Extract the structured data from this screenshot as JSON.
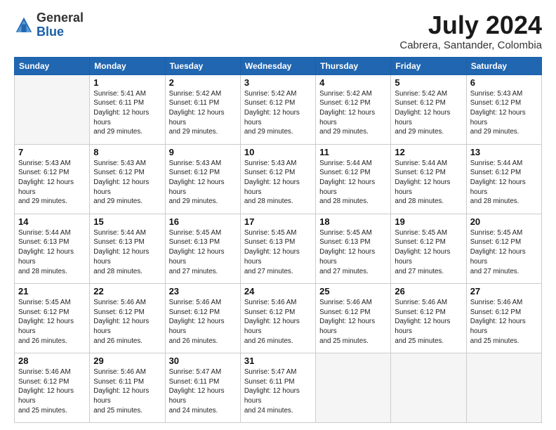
{
  "logo": {
    "general": "General",
    "blue": "Blue"
  },
  "title": "July 2024",
  "subtitle": "Cabrera, Santander, Colombia",
  "days_of_week": [
    "Sunday",
    "Monday",
    "Tuesday",
    "Wednesday",
    "Thursday",
    "Friday",
    "Saturday"
  ],
  "weeks": [
    [
      {
        "day": "",
        "sunrise": "",
        "sunset": "",
        "daylight": ""
      },
      {
        "day": "1",
        "sunrise": "Sunrise: 5:41 AM",
        "sunset": "Sunset: 6:11 PM",
        "daylight": "Daylight: 12 hours and 29 minutes."
      },
      {
        "day": "2",
        "sunrise": "Sunrise: 5:42 AM",
        "sunset": "Sunset: 6:11 PM",
        "daylight": "Daylight: 12 hours and 29 minutes."
      },
      {
        "day": "3",
        "sunrise": "Sunrise: 5:42 AM",
        "sunset": "Sunset: 6:12 PM",
        "daylight": "Daylight: 12 hours and 29 minutes."
      },
      {
        "day": "4",
        "sunrise": "Sunrise: 5:42 AM",
        "sunset": "Sunset: 6:12 PM",
        "daylight": "Daylight: 12 hours and 29 minutes."
      },
      {
        "day": "5",
        "sunrise": "Sunrise: 5:42 AM",
        "sunset": "Sunset: 6:12 PM",
        "daylight": "Daylight: 12 hours and 29 minutes."
      },
      {
        "day": "6",
        "sunrise": "Sunrise: 5:43 AM",
        "sunset": "Sunset: 6:12 PM",
        "daylight": "Daylight: 12 hours and 29 minutes."
      }
    ],
    [
      {
        "day": "7",
        "sunrise": "Sunrise: 5:43 AM",
        "sunset": "Sunset: 6:12 PM",
        "daylight": "Daylight: 12 hours and 29 minutes."
      },
      {
        "day": "8",
        "sunrise": "Sunrise: 5:43 AM",
        "sunset": "Sunset: 6:12 PM",
        "daylight": "Daylight: 12 hours and 29 minutes."
      },
      {
        "day": "9",
        "sunrise": "Sunrise: 5:43 AM",
        "sunset": "Sunset: 6:12 PM",
        "daylight": "Daylight: 12 hours and 29 minutes."
      },
      {
        "day": "10",
        "sunrise": "Sunrise: 5:43 AM",
        "sunset": "Sunset: 6:12 PM",
        "daylight": "Daylight: 12 hours and 28 minutes."
      },
      {
        "day": "11",
        "sunrise": "Sunrise: 5:44 AM",
        "sunset": "Sunset: 6:12 PM",
        "daylight": "Daylight: 12 hours and 28 minutes."
      },
      {
        "day": "12",
        "sunrise": "Sunrise: 5:44 AM",
        "sunset": "Sunset: 6:12 PM",
        "daylight": "Daylight: 12 hours and 28 minutes."
      },
      {
        "day": "13",
        "sunrise": "Sunrise: 5:44 AM",
        "sunset": "Sunset: 6:12 PM",
        "daylight": "Daylight: 12 hours and 28 minutes."
      }
    ],
    [
      {
        "day": "14",
        "sunrise": "Sunrise: 5:44 AM",
        "sunset": "Sunset: 6:13 PM",
        "daylight": "Daylight: 12 hours and 28 minutes."
      },
      {
        "day": "15",
        "sunrise": "Sunrise: 5:44 AM",
        "sunset": "Sunset: 6:13 PM",
        "daylight": "Daylight: 12 hours and 28 minutes."
      },
      {
        "day": "16",
        "sunrise": "Sunrise: 5:45 AM",
        "sunset": "Sunset: 6:13 PM",
        "daylight": "Daylight: 12 hours and 27 minutes."
      },
      {
        "day": "17",
        "sunrise": "Sunrise: 5:45 AM",
        "sunset": "Sunset: 6:13 PM",
        "daylight": "Daylight: 12 hours and 27 minutes."
      },
      {
        "day": "18",
        "sunrise": "Sunrise: 5:45 AM",
        "sunset": "Sunset: 6:13 PM",
        "daylight": "Daylight: 12 hours and 27 minutes."
      },
      {
        "day": "19",
        "sunrise": "Sunrise: 5:45 AM",
        "sunset": "Sunset: 6:12 PM",
        "daylight": "Daylight: 12 hours and 27 minutes."
      },
      {
        "day": "20",
        "sunrise": "Sunrise: 5:45 AM",
        "sunset": "Sunset: 6:12 PM",
        "daylight": "Daylight: 12 hours and 27 minutes."
      }
    ],
    [
      {
        "day": "21",
        "sunrise": "Sunrise: 5:45 AM",
        "sunset": "Sunset: 6:12 PM",
        "daylight": "Daylight: 12 hours and 26 minutes."
      },
      {
        "day": "22",
        "sunrise": "Sunrise: 5:46 AM",
        "sunset": "Sunset: 6:12 PM",
        "daylight": "Daylight: 12 hours and 26 minutes."
      },
      {
        "day": "23",
        "sunrise": "Sunrise: 5:46 AM",
        "sunset": "Sunset: 6:12 PM",
        "daylight": "Daylight: 12 hours and 26 minutes."
      },
      {
        "day": "24",
        "sunrise": "Sunrise: 5:46 AM",
        "sunset": "Sunset: 6:12 PM",
        "daylight": "Daylight: 12 hours and 26 minutes."
      },
      {
        "day": "25",
        "sunrise": "Sunrise: 5:46 AM",
        "sunset": "Sunset: 6:12 PM",
        "daylight": "Daylight: 12 hours and 25 minutes."
      },
      {
        "day": "26",
        "sunrise": "Sunrise: 5:46 AM",
        "sunset": "Sunset: 6:12 PM",
        "daylight": "Daylight: 12 hours and 25 minutes."
      },
      {
        "day": "27",
        "sunrise": "Sunrise: 5:46 AM",
        "sunset": "Sunset: 6:12 PM",
        "daylight": "Daylight: 12 hours and 25 minutes."
      }
    ],
    [
      {
        "day": "28",
        "sunrise": "Sunrise: 5:46 AM",
        "sunset": "Sunset: 6:12 PM",
        "daylight": "Daylight: 12 hours and 25 minutes."
      },
      {
        "day": "29",
        "sunrise": "Sunrise: 5:46 AM",
        "sunset": "Sunset: 6:11 PM",
        "daylight": "Daylight: 12 hours and 25 minutes."
      },
      {
        "day": "30",
        "sunrise": "Sunrise: 5:47 AM",
        "sunset": "Sunset: 6:11 PM",
        "daylight": "Daylight: 12 hours and 24 minutes."
      },
      {
        "day": "31",
        "sunrise": "Sunrise: 5:47 AM",
        "sunset": "Sunset: 6:11 PM",
        "daylight": "Daylight: 12 hours and 24 minutes."
      },
      {
        "day": "",
        "sunrise": "",
        "sunset": "",
        "daylight": ""
      },
      {
        "day": "",
        "sunrise": "",
        "sunset": "",
        "daylight": ""
      },
      {
        "day": "",
        "sunrise": "",
        "sunset": "",
        "daylight": ""
      }
    ]
  ]
}
